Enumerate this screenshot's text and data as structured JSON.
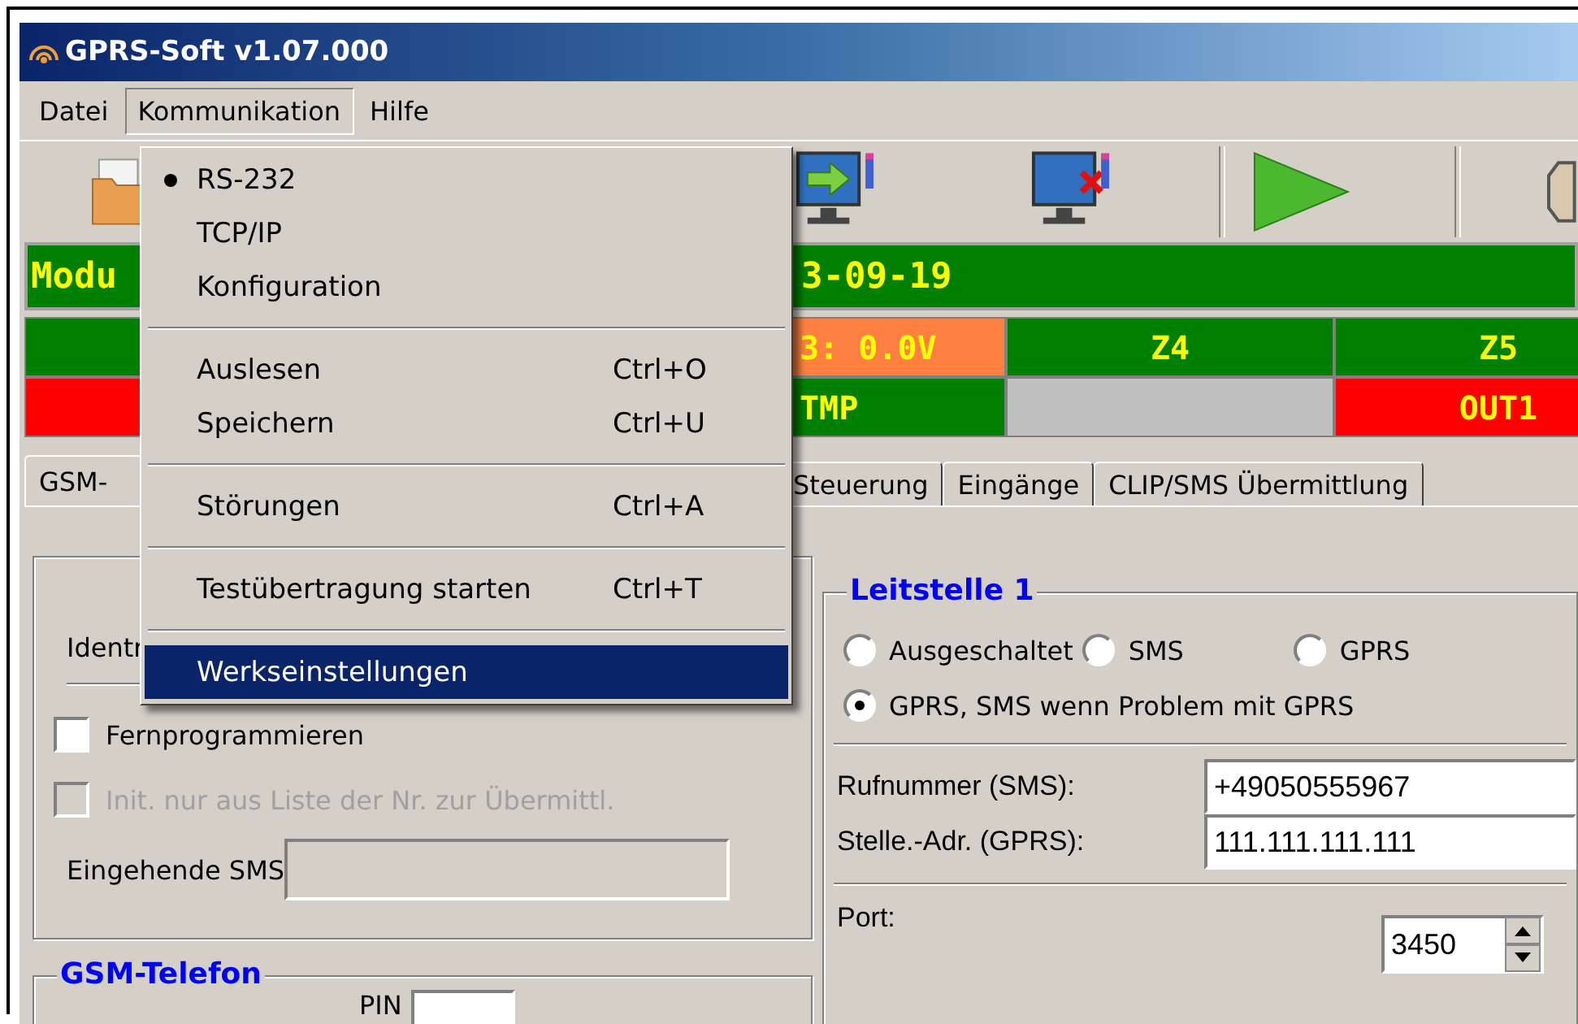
{
  "window": {
    "title": "GPRS-Soft v1.07.000"
  },
  "menu_bar": [
    {
      "label": "Datei",
      "selected": false
    },
    {
      "label": "Kommunikation",
      "selected": true
    },
    {
      "label": "Hilfe",
      "selected": false
    }
  ],
  "menu": [
    {
      "kind": "item",
      "label": "RS-232",
      "checked": true,
      "selected": false
    },
    {
      "kind": "item",
      "label": "TCP/IP",
      "checked": false,
      "selected": false
    },
    {
      "kind": "item",
      "label": "Konfiguration",
      "checked": false,
      "selected": false
    },
    {
      "kind": "separator"
    },
    {
      "kind": "item",
      "label": "Auslesen",
      "shortcut": "Ctrl+O",
      "checked": false,
      "selected": false
    },
    {
      "kind": "item",
      "label": "Speichern",
      "shortcut": "Ctrl+U",
      "checked": false,
      "selected": false
    },
    {
      "kind": "separator"
    },
    {
      "kind": "item",
      "label": "Störungen",
      "shortcut": "Ctrl+A",
      "checked": false,
      "selected": false
    },
    {
      "kind": "separator"
    },
    {
      "kind": "item",
      "label": "Testübertragung starten",
      "shortcut": "Ctrl+T",
      "checked": false,
      "selected": false
    },
    {
      "kind": "separator"
    },
    {
      "kind": "item",
      "label": "Werkseinstellungen",
      "checked": false,
      "selected": true
    }
  ],
  "module_bar": {
    "texts": [
      "Modu",
      "3-09-19"
    ]
  },
  "status_grid": [
    [
      {
        "color": "#008000"
      },
      {
        "color": "#ff8040",
        "text": "3: 0.0V"
      },
      {
        "color": "#008000",
        "text": "Z4"
      },
      {
        "color": "#008000",
        "text": "Z5"
      }
    ],
    [
      {
        "color": "#ff0000"
      },
      {
        "color": "#008000",
        "text": "TMP"
      },
      {
        "color": "#c0c0c0"
      },
      {
        "color": "#ff0000",
        "text": "OUT1"
      }
    ]
  ],
  "tabs": [
    {
      "label": "GSM-",
      "selected": true
    },
    {
      "label": "Steuerung",
      "selected": false
    },
    {
      "label": "Eingänge",
      "selected": false
    },
    {
      "label": "CLIP/SMS Übermittlung",
      "selected": false
    }
  ],
  "identification": {
    "label": "Identr"
  },
  "options": [
    {
      "label": "Fernprogrammieren",
      "checked": false,
      "disabled": false
    },
    {
      "label": "Init. nur aus Liste der Nr. zur Übermittl.",
      "checked": false,
      "disabled": true
    }
  ],
  "incoming_sms": {
    "label": "Eingehende SMS",
    "disabled": true
  },
  "gsm_phone": {
    "title": "GSM-Telefon",
    "pin_label": "PIN"
  },
  "station": {
    "title": "Leitstelle 1",
    "modes": [
      {
        "label": "Ausgeschaltet",
        "selected": false
      },
      {
        "label": "SMS",
        "selected": false
      },
      {
        "label": "GPRS",
        "selected": false
      },
      {
        "label": "GPRS, SMS wenn Problem mit GPRS",
        "selected": true
      }
    ],
    "fields": [
      {
        "label": "Rufnummer (SMS):",
        "value": "+49050555967"
      },
      {
        "label": "Stelle.-Adr. (GPRS):",
        "value": "111.111.111.111"
      }
    ],
    "port": {
      "label": "Port:",
      "value": "3450"
    }
  }
}
